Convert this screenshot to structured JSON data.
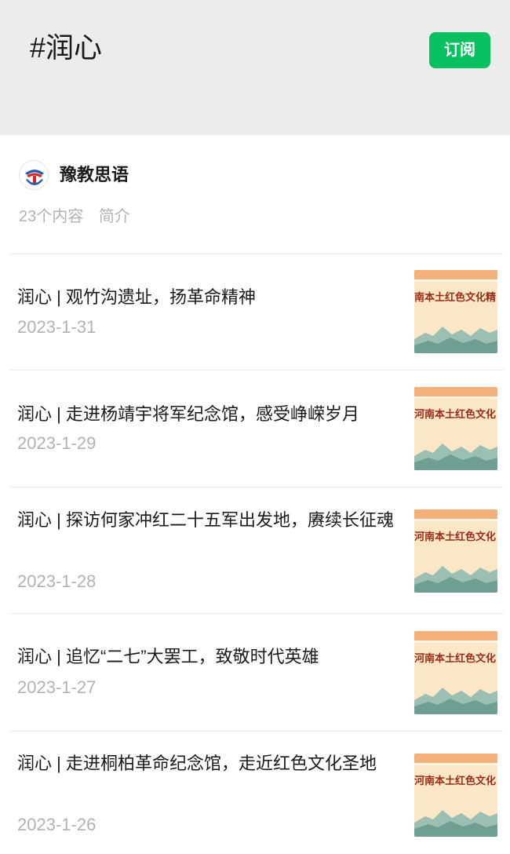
{
  "header": {
    "title": "#润心",
    "subscribe_label": "订阅"
  },
  "account": {
    "name": "豫教思语",
    "content_count": "23个内容",
    "intro_label": "简介",
    "avatar_icon": "henan-education-logo-icon"
  },
  "articles": [
    {
      "title": "润心 | 观竹沟遗址，扬革命精神",
      "date": "2023-1-31",
      "thumb_text": "南本土红色文化精"
    },
    {
      "title": "润心 | 走进杨靖宇将军纪念馆，感受峥嵘岁月",
      "date": "2023-1-29",
      "thumb_text": "河南本土红色文化"
    },
    {
      "title": "润心 | 探访何家冲红二十五军出发地，赓续长征魂",
      "date": "2023-1-28",
      "thumb_text": "河南本土红色文化"
    },
    {
      "title": "润心 | 追忆“二七”大罢工，致敬时代英雄",
      "date": "2023-1-27",
      "thumb_text": "河南本土红色文化"
    },
    {
      "title": "润心 | 走进桐柏革命纪念馆，走近红色文化圣地",
      "date": "2023-1-26",
      "thumb_text": "河南本土红色文化"
    }
  ],
  "colors": {
    "accent": "#07c160",
    "header_bg": "#ececec",
    "muted_text": "#b2b2b2"
  }
}
